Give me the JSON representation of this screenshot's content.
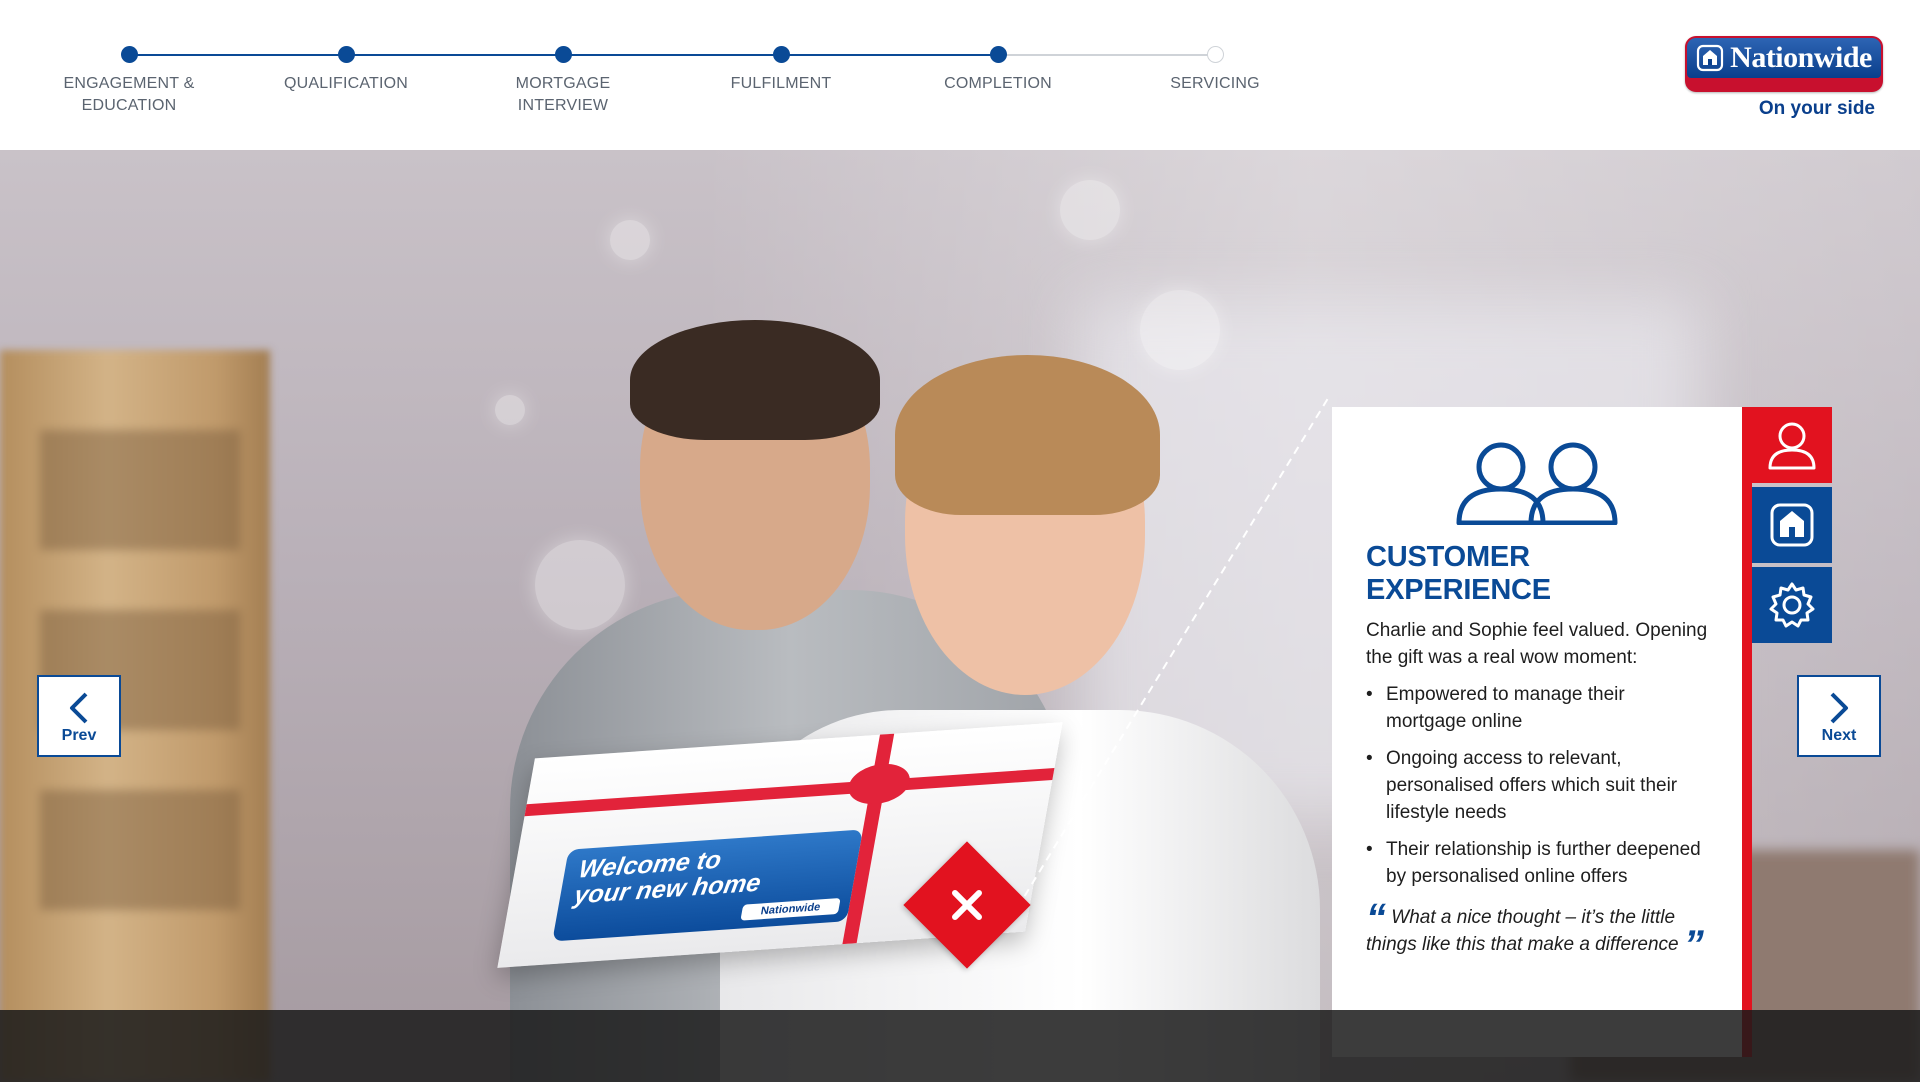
{
  "progress": {
    "steps": [
      {
        "label_line1": "ENGAGEMENT &",
        "label_line2": "EDUCATION",
        "status": "complete"
      },
      {
        "label_line1": "QUALIFICATION",
        "label_line2": "",
        "status": "complete"
      },
      {
        "label_line1": "MORTGAGE",
        "label_line2": "INTERVIEW",
        "status": "complete"
      },
      {
        "label_line1": "FULFILMENT",
        "label_line2": "",
        "status": "complete"
      },
      {
        "label_line1": "COMPLETION",
        "label_line2": "",
        "status": "current"
      },
      {
        "label_line1": "SERVICING",
        "label_line2": "",
        "status": "pending"
      }
    ]
  },
  "brand": {
    "name": "Nationwide",
    "tagline": "On your side"
  },
  "scene": {
    "gift_card_line1": "Welcome to",
    "gift_card_line2": "your new home",
    "gift_card_logo": "Nationwide"
  },
  "nav": {
    "prev_label": "Prev",
    "next_label": "Next"
  },
  "panel": {
    "icon": "two-people-icon",
    "title": "CUSTOMER EXPERIENCE",
    "intro": "Charlie and Sophie feel valued. Opening the gift was a real wow moment:",
    "bullets": [
      "Empowered to manage their mortgage online",
      "Ongoing access to relevant, personalised offers which suit their lifestyle needs",
      "Their relationship is further deepened by personalised online offers"
    ],
    "quote": "What a nice thought – it’s the little things like this that make a difference"
  },
  "tabs": [
    {
      "icon": "person-icon",
      "color": "#e2121f"
    },
    {
      "icon": "nationwide-building-icon",
      "color": "#0a4a96"
    },
    {
      "icon": "gear-icon",
      "color": "#0a4a96"
    }
  ],
  "colors": {
    "primary_blue": "#0a4a96",
    "accent_red": "#e2121f",
    "inactive_track": "#cfd3d8"
  }
}
